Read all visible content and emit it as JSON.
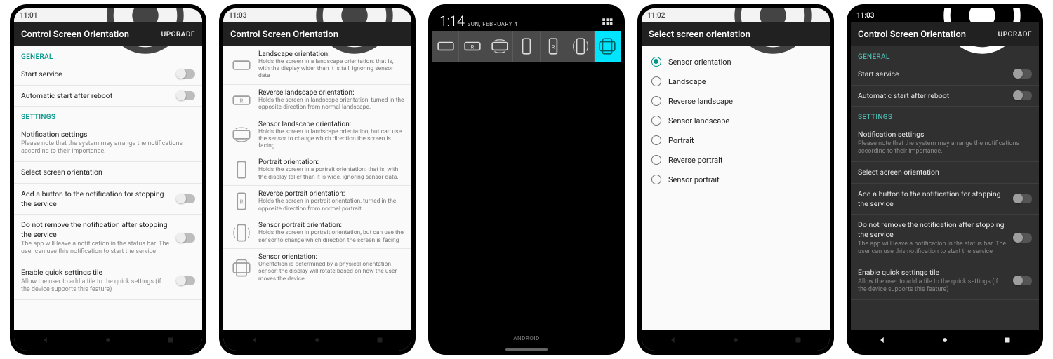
{
  "statusbar": {
    "t1": "11:01",
    "t2": "11:03",
    "t3": "1:14",
    "t4": "11:02",
    "t5": "11:03"
  },
  "app": {
    "title": "Control Screen Orientation",
    "upgrade": "UPGRADE",
    "select_title": "Select screen orientation"
  },
  "sections": {
    "general": "GENERAL",
    "settings": "SETTINGS"
  },
  "settings": {
    "start_service": "Start service",
    "auto_start": "Automatic start after reboot",
    "notif_title": "Notification settings",
    "notif_sub": "Please note that the system may arrange the notifications according to their importance.",
    "select_orient": "Select screen orientation",
    "add_button": "Add a button to the notification for stopping the service",
    "dont_remove_title": "Do not remove the notification after stopping the service",
    "dont_remove_sub": "The app will leave a notification in the status bar. The user can use this notification to start the service",
    "quick_tile_title": "Enable quick settings tile",
    "quick_tile_sub": "Allow the user to add a tile to the quick settings (if the device supports this feature)"
  },
  "orientations": [
    {
      "title": "Landscape orientation:",
      "desc": "Holds the screen in a landscape orientation: that is, with the display wider than it is tall, ignoring sensor data"
    },
    {
      "title": "Reverse landscape orientation:",
      "desc": "Holds the screen in landscape orientation, turned in the opposite direction from normal landscape."
    },
    {
      "title": "Sensor landscape orientation:",
      "desc": "Holds the screen in landscape orientation, but can use the sensor to change which direction the screen is facing."
    },
    {
      "title": "Portrait orientation:",
      "desc": "Holds the screen in a portrait orientation: that is, with the display taller than it is wide, ignoring sensor data."
    },
    {
      "title": "Reverse portrait orientation:",
      "desc": "Holds the screen in portrait orientation, turned in the opposite direction from normal portrait."
    },
    {
      "title": "Sensor portrait orientation:",
      "desc": "Holds the screen in portrait orientation, but can use the sensor to change which direction the screen is facing"
    },
    {
      "title": "Sensor orientation:",
      "desc": "Orientation is determined by a physical orientation sensor: the display will rotate based on how the user moves the device."
    }
  ],
  "radio_options": [
    "Sensor orientation",
    "Landscape",
    "Reverse landscape",
    "Sensor landscape",
    "Portrait",
    "Reverse portrait",
    "Sensor portrait"
  ],
  "lockscreen": {
    "clock": "1:14",
    "date": "SUN, FEBRUARY 4",
    "footer": "ANDROID"
  }
}
